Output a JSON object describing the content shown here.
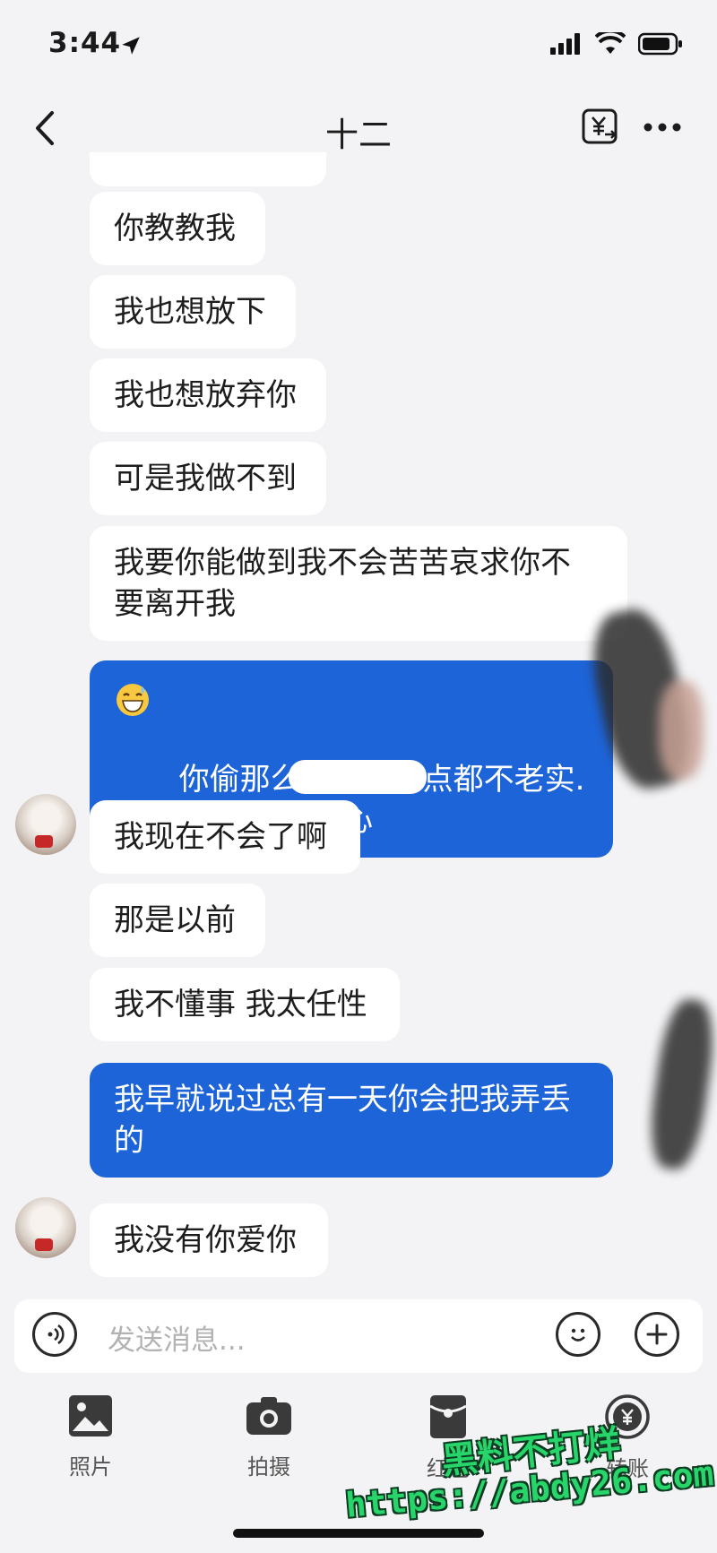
{
  "status_bar": {
    "time": "3:44"
  },
  "header": {
    "title": "十二"
  },
  "messages": [
    {
      "text": "你教教我"
    },
    {
      "text": "我也想放下"
    },
    {
      "text": "我也想放弃你"
    },
    {
      "text": "可是我做不到"
    },
    {
      "text": "我要你能做到我不会苦苦哀求你不\n要离开我"
    },
    {
      "text": "你偷那么多次人一点都不老实.\n已经伤透我的心"
    },
    {
      "text": "我现在不会了啊"
    },
    {
      "text": "那是以前"
    },
    {
      "text": "我不懂事 我太任性"
    },
    {
      "text": "我早就说过总有一天你会把我弄丢\n的"
    },
    {
      "text": "我没有你爱你"
    }
  ],
  "input": {
    "placeholder": "发送消息..."
  },
  "toolbar": {
    "photo_label": "照片",
    "camera_label": "拍摄",
    "redpacket_label": "红包",
    "transfer_label": "转账"
  },
  "watermark": {
    "line1": "黑料不打烊",
    "line2": "https://abdy26.com"
  },
  "colors": {
    "outgoing_bubble": "#1d64d8",
    "background": "#f3f3f5"
  }
}
